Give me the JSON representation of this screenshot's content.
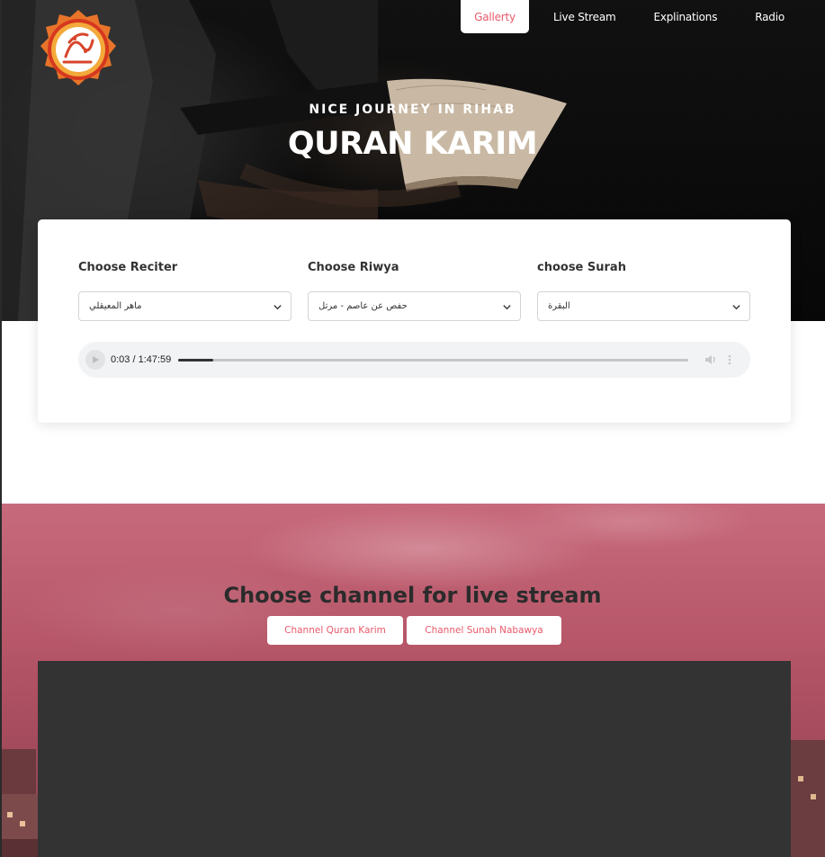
{
  "nav": {
    "items": [
      {
        "label": "Gallerty",
        "active": true
      },
      {
        "label": "Live Stream",
        "active": false
      },
      {
        "label": "Explinations",
        "active": false
      },
      {
        "label": "Radio",
        "active": false
      }
    ]
  },
  "hero": {
    "subtitle": "NICE JOURNEY IN RIHAB",
    "title": "QURAN KARIM",
    "logo_icon": "quran-calligraphy-logo"
  },
  "player": {
    "reciter": {
      "label": "Choose Reciter",
      "value": "ماهر المعيقلي"
    },
    "riwya": {
      "label": "Choose Riwya",
      "value": "حفص عن عاصم - مرتل"
    },
    "surah": {
      "label": "choose Surah",
      "value": "البقرة"
    },
    "audio": {
      "time": "0:03 / 1:47:59",
      "progress": 0.0005
    }
  },
  "live": {
    "title": "Choose channel for live stream",
    "channels": [
      "Channel Quran Karim",
      "Channel Sunah Nabawya"
    ]
  },
  "colors": {
    "accent": "#e85a6b",
    "live_bg": "#b65668",
    "video_bg": "#333333"
  }
}
